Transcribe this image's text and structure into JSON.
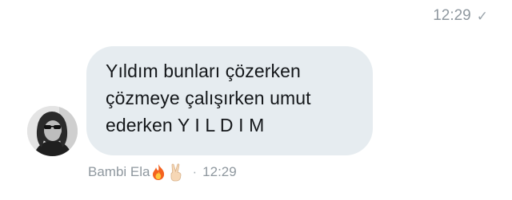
{
  "previous_message": {
    "time": "12:29",
    "status_icon": "check-icon"
  },
  "incoming_message": {
    "sender_avatar": "avatar",
    "lines": [
      "Yıldım bunları çözerken",
      "çözmeye çalışırken umut",
      "ederken Y I L D I M"
    ],
    "sender_name": "Bambi Ela",
    "sender_emojis": [
      "fire-icon",
      "victory-hand-icon"
    ],
    "separator": "·",
    "time": "12:29"
  },
  "colors": {
    "bubble_bg": "#e6ecf0",
    "text": "#14171a",
    "meta_text": "#8f989f",
    "background": "#ffffff"
  }
}
